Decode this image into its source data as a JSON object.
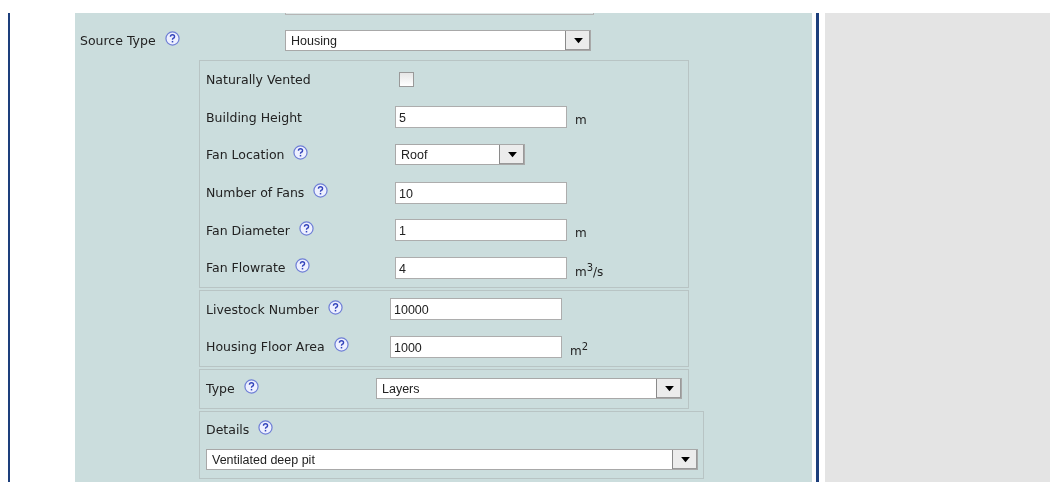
{
  "source_type": {
    "label": "Source Type",
    "help": true,
    "value": "Housing"
  },
  "groups": [
    {
      "rows": [
        {
          "kind": "checkbox",
          "label": "Naturally Vented",
          "help": false,
          "checked": false
        },
        {
          "kind": "input",
          "label": "Building Height",
          "help": false,
          "value": "5",
          "unit": "m"
        },
        {
          "kind": "select",
          "label": "Fan Location",
          "help": true,
          "value": "Roof"
        },
        {
          "kind": "input",
          "label": "Number of Fans",
          "help": true,
          "value": "10"
        },
        {
          "kind": "input",
          "label": "Fan Diameter",
          "help": true,
          "value": "1",
          "unit": "m"
        },
        {
          "kind": "input",
          "label": "Fan Flowrate",
          "help": true,
          "value": "4",
          "unit": "m$^{3}$/s"
        }
      ]
    },
    {
      "rows": [
        {
          "kind": "input",
          "label": "Livestock Number",
          "help": true,
          "value": "10000"
        },
        {
          "kind": "input",
          "label": "Housing Floor Area",
          "help": true,
          "value": "1000",
          "unit": "m$^{2}$"
        }
      ]
    },
    {
      "rows": [
        {
          "kind": "wide_select",
          "label": "Type",
          "help": true,
          "value": "Layers"
        }
      ]
    },
    {
      "rows": [
        {
          "kind": "select_below",
          "label": "Details",
          "help": true,
          "value": "Ventilated deep pit"
        }
      ]
    }
  ]
}
